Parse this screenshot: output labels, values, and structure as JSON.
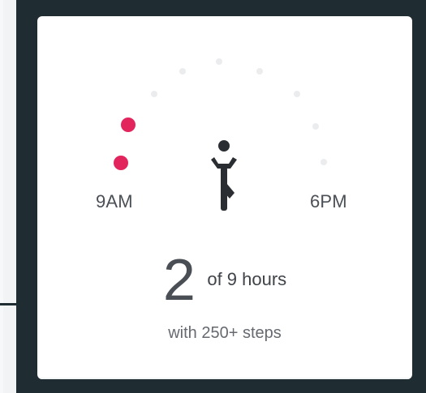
{
  "card": {
    "time_range": {
      "start": "9AM",
      "end": "6PM"
    },
    "summary": {
      "hours_active": "2",
      "hours_label": "of 9 hours",
      "detail": "with 250+ steps"
    },
    "hour_dots": [
      {
        "id": "hour-1",
        "state": "active"
      },
      {
        "id": "hour-2",
        "state": "active"
      },
      {
        "id": "hour-3",
        "state": "inactive"
      },
      {
        "id": "hour-4",
        "state": "inactive"
      },
      {
        "id": "hour-5",
        "state": "inactive"
      },
      {
        "id": "hour-6",
        "state": "inactive"
      },
      {
        "id": "hour-7",
        "state": "inactive"
      },
      {
        "id": "hour-8",
        "state": "inactive"
      },
      {
        "id": "hour-9",
        "state": "inactive"
      }
    ]
  },
  "colors": {
    "background": "#1f2d33",
    "card": "#ffffff",
    "active_dot": "#e2255d",
    "inactive_dot": "#d7dadd",
    "text_primary": "#3f4348",
    "text_secondary": "#666a70",
    "icon": "#2a2d31"
  },
  "icons": {
    "activity_figure": "person-tree-pose-icon"
  }
}
